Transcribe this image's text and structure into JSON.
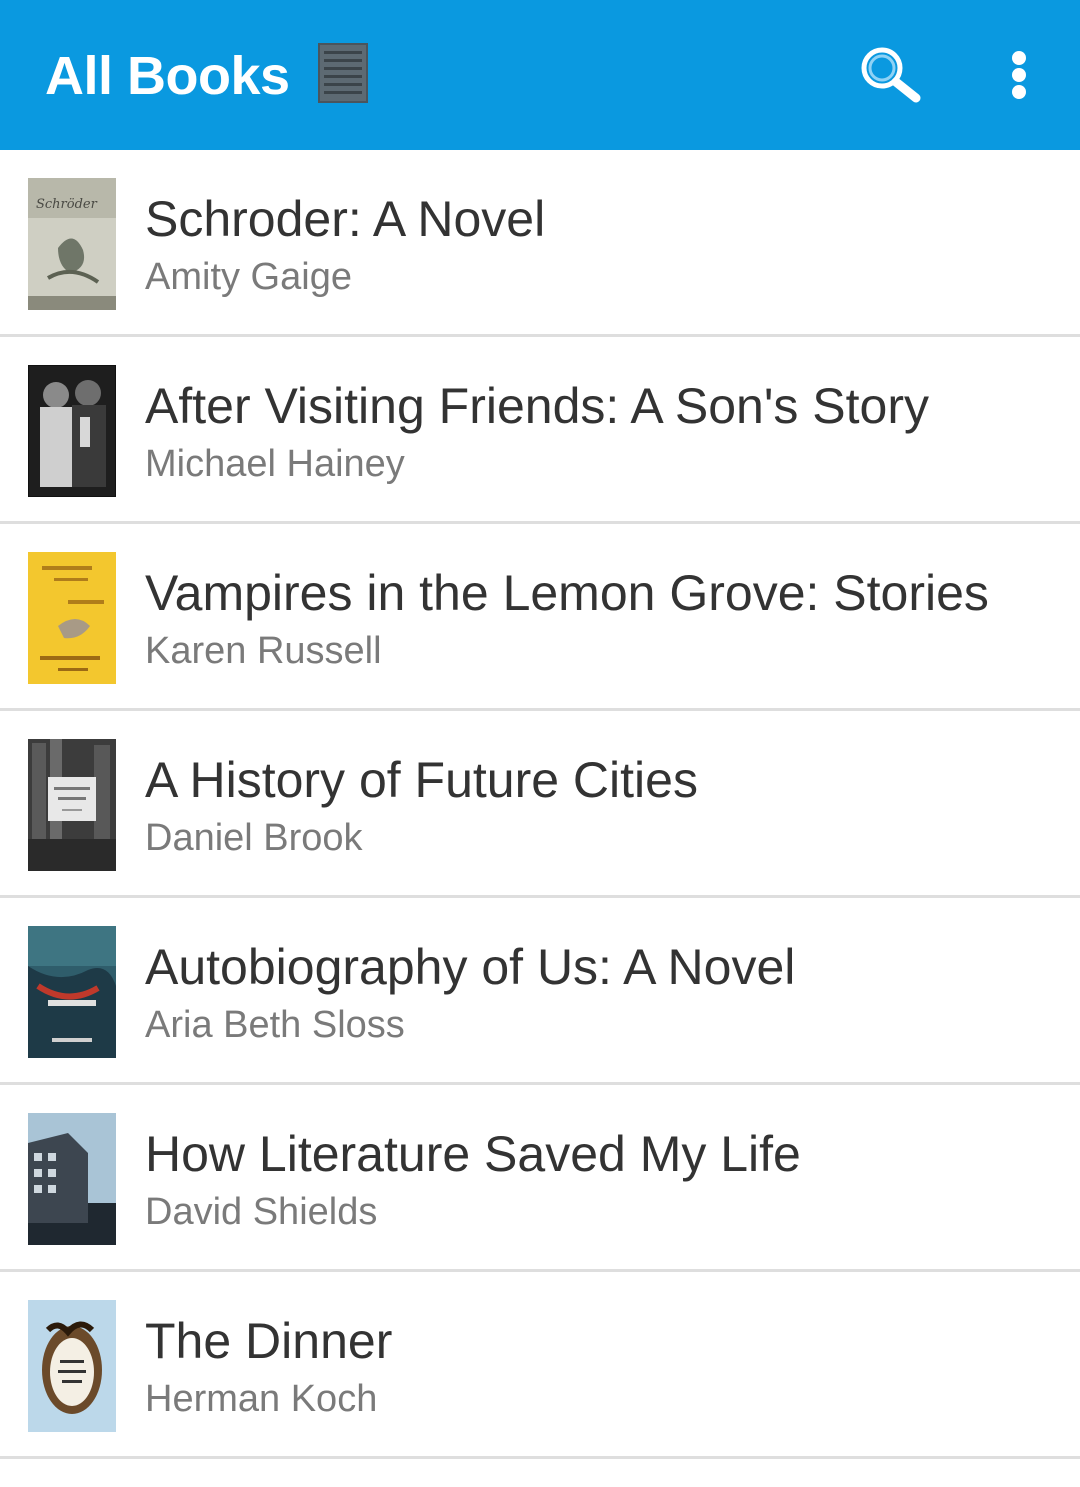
{
  "app_bar": {
    "title": "All Books",
    "background": "#0a99e0",
    "icons": [
      "list-view-icon",
      "search-icon",
      "overflow-menu-icon"
    ]
  },
  "books": [
    {
      "title": "Schroder: A Novel",
      "author": "Amity Gaige",
      "cover_color": "#c9c9be"
    },
    {
      "title": "After Visiting Friends: A Son's Story",
      "author": "Michael Hainey",
      "cover_color": "#2a2a2a"
    },
    {
      "title": "Vampires in the Lemon Grove: Stories",
      "author": "Karen Russell",
      "cover_color": "#f2c530"
    },
    {
      "title": "A History of Future Cities",
      "author": "Daniel Brook",
      "cover_color": "#4a4a4a"
    },
    {
      "title": "Autobiography of Us: A Novel",
      "author": "Aria Beth Sloss",
      "cover_color": "#2f5f6e"
    },
    {
      "title": "How Literature Saved My Life",
      "author": "David Shields",
      "cover_color": "#8fb3cc"
    },
    {
      "title": "The Dinner",
      "author": "Herman Koch",
      "cover_color": "#b9d7e8"
    }
  ]
}
